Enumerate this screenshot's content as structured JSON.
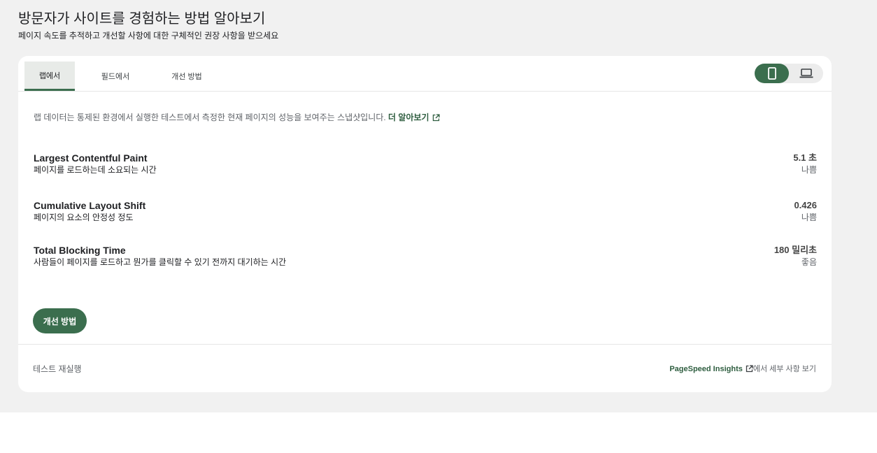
{
  "header": {
    "title": "방문자가 사이트를 경험하는 방법 알아보기",
    "subtitle": "페이지 속도를 추적하고 개선할 사항에 대한 구체적인 권장 사항을 받으세요"
  },
  "tabs": [
    {
      "label": "랩에서",
      "active": true
    },
    {
      "label": "필드에서",
      "active": false
    },
    {
      "label": "개선 방법",
      "active": false
    }
  ],
  "device_toggle": {
    "mobile_icon": "mobile-phone-icon",
    "desktop_icon": "laptop-icon",
    "selected": "mobile"
  },
  "intro": {
    "text": "랩 데이터는 통제된 환경에서 실행한 테스트에서 측정한 현재 페이지의 성능을 보여주는 스냅샷입니다.",
    "link": "더 알아보기",
    "link_icon": "external-link-icon"
  },
  "metrics": [
    {
      "name": "Largest Contentful Paint",
      "desc": "페이지를 로드하는데 소요되는 시간",
      "value": "5.1 초",
      "rating": "나쁨"
    },
    {
      "name": "Cumulative Layout Shift",
      "desc": "페이지의 요소의 안정성 정도",
      "value": "0.426",
      "rating": "나쁨"
    },
    {
      "name": "Total Blocking Time",
      "desc": "사람들이 페이지를 로드하고 뭔가를 클릭할 수 있기 전까지 대기하는 시간",
      "value": "180 밀리초",
      "rating": "좋음"
    }
  ],
  "improve_button": "개선 방법",
  "footer": {
    "rerun": "테스트 재실행",
    "psi_link": "PageSpeed Insights",
    "psi_suffix": "에서 세부 사항 보기"
  },
  "colors": {
    "accent": "#3b6e4e",
    "background": "#f1f1f1"
  }
}
